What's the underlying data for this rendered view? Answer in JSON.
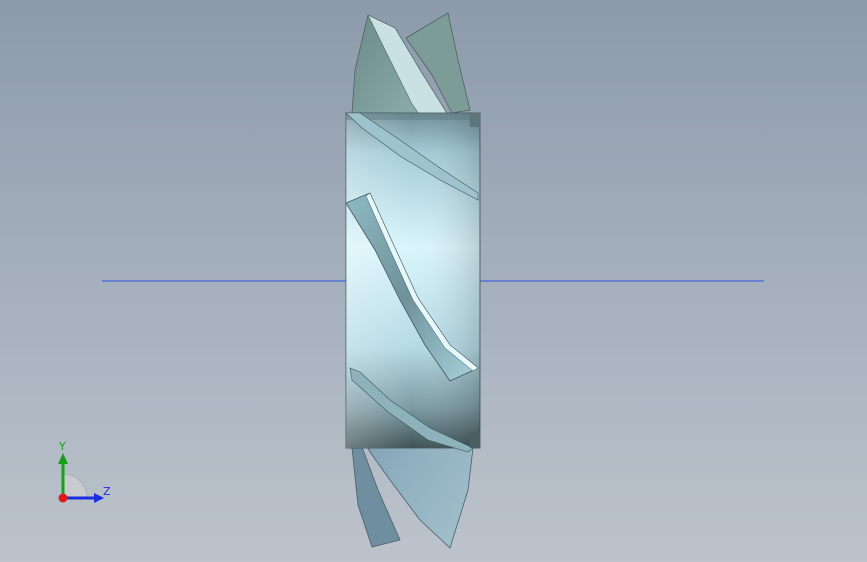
{
  "viewport": {
    "background_top": "#8c9aab",
    "background_bottom": "#bcc3cc",
    "axis_line_color": "#2b55e6"
  },
  "model": {
    "hub_color": "#a9d3de",
    "blade_color": "#7fa0a6",
    "blade_shadow_color": "#5b7478"
  },
  "triad": {
    "y_label": "Y",
    "z_label": "Z",
    "y_color": "#16a016",
    "z_color": "#1a2ee0",
    "x_color": "#e01a1a"
  }
}
